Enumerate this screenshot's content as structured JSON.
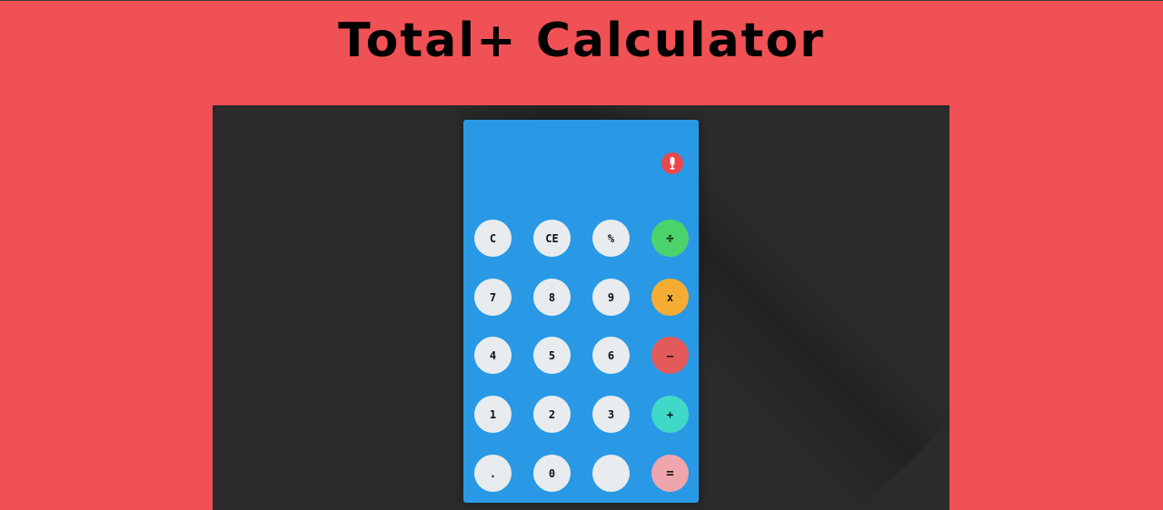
{
  "header": {
    "title": "Total+ Calculator"
  },
  "calculator": {
    "display_value": "",
    "mic_icon": "microphone-icon",
    "colors": {
      "body": "#2999e6",
      "button": "#e8ecef",
      "divide": "#4cd26a",
      "multiply": "#f5ac33",
      "subtract": "#e35a5a",
      "add": "#40d9c8",
      "equals": "#eea5ab",
      "mic": "#e9474b",
      "page_background": "#f05155",
      "stage_background": "#2b2b2b"
    },
    "buttons": {
      "clear": "C",
      "clear_entry": "CE",
      "percent": "%",
      "divide": "÷",
      "seven": "7",
      "eight": "8",
      "nine": "9",
      "multiply": "x",
      "four": "4",
      "five": "5",
      "six": "6",
      "subtract": "–",
      "one": "1",
      "two": "2",
      "three": "3",
      "add": "+",
      "decimal": ".",
      "zero": "0",
      "blank": "",
      "equals": "="
    }
  }
}
